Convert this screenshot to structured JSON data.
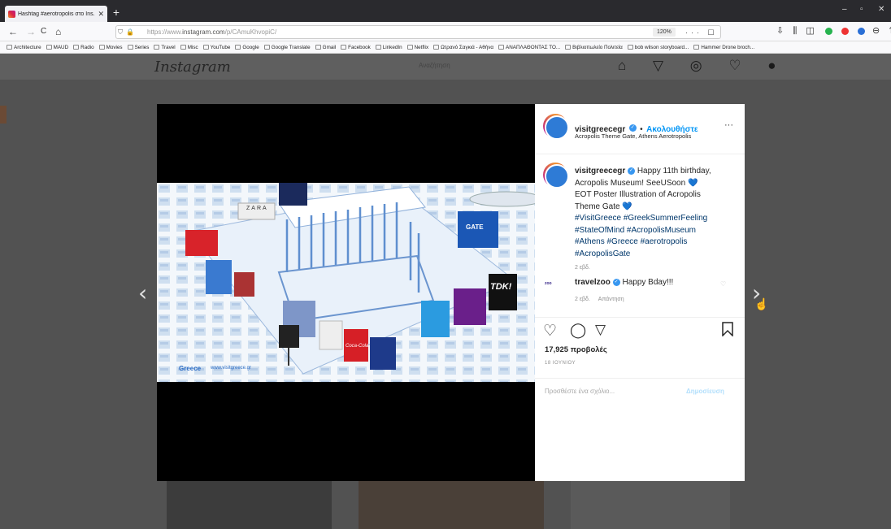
{
  "browser": {
    "tab_title": "Hashtag #aerotropolis στο Ins...",
    "tab_close": "✕",
    "new_tab": "+",
    "url_prefix": "https://www.",
    "url_main": "instagram.com",
    "url_suffix": "/p/CAmuKhvopiC/",
    "zoom": "120%",
    "url_actions": "··· ☐ ☆",
    "toolbar_icons": "⇩ ⫼ ◫",
    "toolbar_tail": "⊖ ⇈ ≡",
    "window_controls": [
      "–",
      "▫",
      "✕"
    ],
    "nav": {
      "back": "←",
      "forward": "→",
      "reload": "C",
      "home": "⌂"
    }
  },
  "bookmarks": [
    "Architecture",
    "MAUD",
    "Radio",
    "Movies",
    "Series",
    "Travel",
    "Misc",
    "YouTube",
    "Google",
    "Google Translate",
    "Gmail",
    "Facebook",
    "LinkedIn",
    "Netflix",
    "Ωτρανό Σαγκιά - Αθήνα",
    "ΑΝΑΠΛΑΘΟΝΤΑΣ ΤΟ...",
    "Βιβλιοπωλείο Πολιτεία",
    "bob wilson storyboard...",
    "Hammer Drone broch..."
  ],
  "page": {
    "logo": "Instagram",
    "search_placeholder": "Αναζήτηση",
    "nav_icons": "⌂ ▽ ◎ ♡ ●"
  },
  "post": {
    "account": "visitgreecegr",
    "follow": "Ακολουθήστε",
    "dot": "•",
    "more": "···",
    "location": "Acropolis Theme Gate, Athens Aerotropolis",
    "caption_user": "visitgreecegr",
    "caption_lines": [
      "Happy 11th birthday,",
      "Acropolis Museum! SeeUSoon 💙",
      "EOT Poster Illustration of Acropolis",
      "Theme Gate 💙"
    ],
    "hashtag_lines": [
      "#VisitGreece #GreekSummerFeeling",
      "#StateOfMind #AcropolisMuseum",
      "#Athens #Greece #aerotropolis",
      "#AcropolisGate"
    ],
    "caption_time": "2 εβδ.",
    "comment_user": "travelzoo",
    "comment_text": "Happy Bday!!!",
    "comment_time": "2 εβδ.",
    "reply": "Απάντηση",
    "views": "17,925 προβολές",
    "post_date": "18 ΙΟΥΝΙΟΥ",
    "add_comment_placeholder": "Προσθέστε ένα σχόλιο...",
    "publish": "Δημοσίευση"
  },
  "poster": {
    "brand": "Greece",
    "site": "www.visitgreece.gr",
    "gate": "GATE",
    "tdk": "TDK!",
    "zara": "ZARA",
    "coca": "Coca-Cola"
  },
  "colors": {
    "accent": "#3897f0",
    "follow": "#0095f6",
    "overlay": "#525252"
  }
}
